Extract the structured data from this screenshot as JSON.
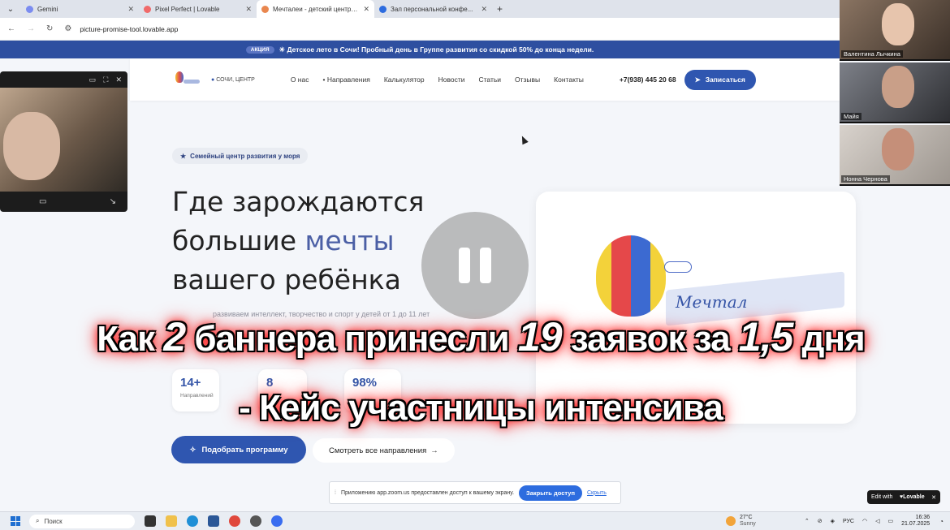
{
  "browser": {
    "tabs": [
      {
        "title": "Gemini",
        "close": "✕"
      },
      {
        "title": "Pixel Perfect | Lovable",
        "close": "✕"
      },
      {
        "title": "Мечталеи - детский центр р...",
        "close": "✕"
      },
      {
        "title": "Зал персональной конфе...",
        "close": "✕"
      }
    ],
    "new_tab": "+",
    "url": "picture-promise-tool.lovable.app"
  },
  "promo": {
    "badge": "АКЦИЯ",
    "text": "☀ Детское лето в Сочи! Пробный день в Группе развития со скидкой 50% до конца недели."
  },
  "header": {
    "city": "СОЧИ, ЦЕНТР",
    "nav": [
      "О нас",
      "Направления",
      "Калькулятор",
      "Новости",
      "Статьи",
      "Отзывы",
      "Контакты"
    ],
    "phone": "+7(938) 445 20 68",
    "cta": "Записаться"
  },
  "hero": {
    "badge": "Семейный центр развития у моря",
    "title_line1": "Где зарождаются",
    "title_line2_a": "большие ",
    "title_line2_b": "мечты",
    "title_line3": "вашего ребёнка",
    "subtitle": "развиваем интеллект, творчество и спорт у детей от 1 до 11 лет",
    "stats": [
      {
        "value": "14+",
        "label": "Направлений"
      },
      {
        "value": "8",
        "label": ""
      },
      {
        "value": "98%",
        "label": ""
      }
    ],
    "primary_button": "Подобрать программу",
    "secondary_button": "Смотреть все направления",
    "card_text": "Мечтал"
  },
  "overlay": {
    "line1_a": "Как ",
    "line1_n1": "2",
    "line1_b": " баннера принесли ",
    "line1_n2": "19",
    "line1_c": " заявок за ",
    "line1_n3": "1,5",
    "line1_d": " дня",
    "line2": "- Кейс участницы интенсива"
  },
  "zoom": {
    "participants": [
      "Валентина Лычкина",
      "Майя",
      "Нонна Чернова"
    ]
  },
  "share_notice": {
    "text": "Приложению app.zoom.us предоставлен доступ к вашему экрану.",
    "stop": "Закрыть доступ",
    "hide": "Скрыть"
  },
  "lovable_badge": {
    "label": "Edit with",
    "brand": "♥Lovable",
    "close": "✕"
  },
  "taskbar": {
    "search": "Поиск",
    "weather_temp": "27°C",
    "weather_desc": "Sunny",
    "lang": "РУС",
    "time": "16:36",
    "date": "21.07.2025"
  },
  "colors": {
    "accent": "#2f56b0",
    "promo_bg": "#2e4fa0",
    "headline_glow": "#ff1a1a"
  }
}
